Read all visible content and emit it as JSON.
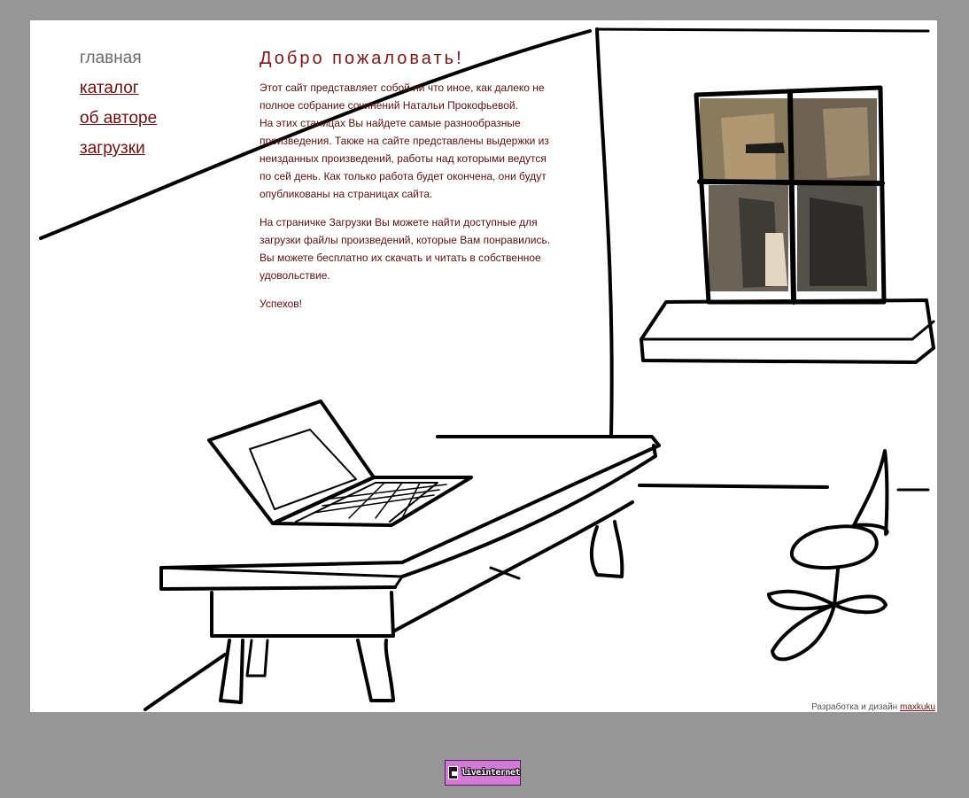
{
  "nav": {
    "items": [
      {
        "label": "главная",
        "current": true
      },
      {
        "label": "каталог",
        "current": false
      },
      {
        "label": "об авторе",
        "current": false
      },
      {
        "label": "загрузки",
        "current": false
      }
    ]
  },
  "content": {
    "title": "Добро пожаловать!",
    "paragraph1_line1": "Этот сайт представляет собой ни что иное, как далеко не полное собрание сочинений Натальи Прокофьевой.",
    "paragraph1_line2": "На этих станицах Вы найдете самые разнообразные произведения. Также на сайте представлены выдержки из неизданных произведений, работы над которыми ведутся по сей день. Как только работа будет окончена, они будут опубликованы на страницах сайта.",
    "paragraph2": "На страничке Загрузки Вы можете найти доступные для загрузки файлы произведений, которые Вам понравились. Вы можете бесплатно их скачать и читать в собственное удовольствие.",
    "paragraph3": "Успехов!"
  },
  "credits": {
    "text": "Разработка и дизайн",
    "link": "maxkuku"
  },
  "counter": {
    "label": "liveinternet"
  },
  "colors": {
    "page_background": "#969696",
    "canvas_background": "#ffffff",
    "link": "#6b1010",
    "text": "#5a1010"
  }
}
